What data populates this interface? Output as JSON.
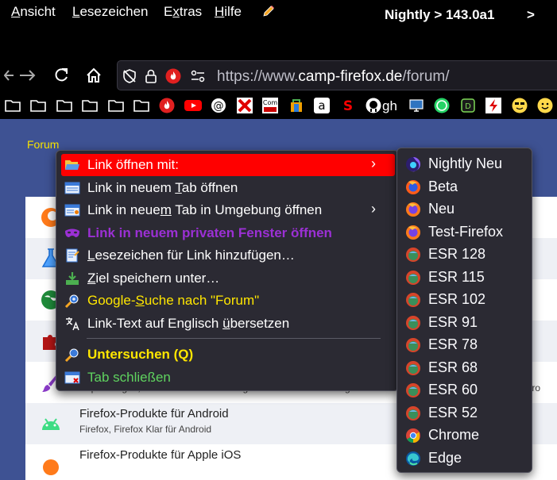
{
  "menubar": {
    "items": [
      "Ansicht",
      "Lesezeichen",
      "Extras",
      "Hilfe"
    ],
    "title": "Nightly > 143.0a1",
    "title_arrow": ">"
  },
  "navbar": {
    "url_prefix": "https://www.",
    "url_host": "camp-firefox.de",
    "url_path": "/forum/"
  },
  "bookmarks": {
    "label": "gh"
  },
  "page": {
    "breadcrumb": "Forum",
    "rows": [
      {
        "title": "",
        "desc": ""
      },
      {
        "title": "",
        "desc": ""
      },
      {
        "title": "",
        "desc": ""
      },
      {
        "title": "",
        "desc": ""
      },
      {
        "title": "",
        "desc": "Anpassungen, welche über Erweiterungen und Themes hinausg",
        "tail": "rChro"
      },
      {
        "title": "Firefox-Produkte für Android",
        "desc": "Firefox, Firefox Klar für Android"
      },
      {
        "title": "Firefox-Produkte für Apple iOS",
        "desc": ""
      }
    ]
  },
  "context_menu": {
    "items": [
      {
        "label": "Link öffnen mit:",
        "color": "#ffffff",
        "bold": false,
        "submenu": true,
        "highlight": true
      },
      {
        "pre": "Link in neuem ",
        "u": "T",
        "post": "ab öffnen",
        "color": "#ffffff"
      },
      {
        "pre": "Link in neue",
        "u": "m",
        "post": " Tab in Umgebung öffnen",
        "color": "#ffffff",
        "submenu": true
      },
      {
        "label": "Link in neuem privaten Fenster öffnen",
        "color": "#9b30d4",
        "bold": true
      },
      {
        "pre": "",
        "u": "L",
        "post": "esezeichen für Link hinzufügen…",
        "color": "#ffffff"
      },
      {
        "pre": "",
        "u": "Z",
        "post": "iel speichern unter…",
        "color": "#ffffff"
      },
      {
        "pre": "Google-",
        "u": "S",
        "post": "uche nach \"Forum\"",
        "color": "#ffe600"
      },
      {
        "pre": "Link-Text auf Englisch ",
        "u": "ü",
        "post": "bersetzen",
        "color": "#ffffff"
      },
      {
        "label": "Untersuchen (Q)",
        "color": "#ffe600",
        "bold": true
      },
      {
        "label": "Tab schließen",
        "color": "#5fd35f"
      }
    ]
  },
  "submenu": {
    "items": [
      {
        "label": "Nightly Neu",
        "icon": "nightly-icon"
      },
      {
        "label": "Beta",
        "icon": "firefox-beta-icon"
      },
      {
        "label": "Neu",
        "icon": "firefox-icon"
      },
      {
        "label": "Test-Firefox",
        "icon": "firefox-icon"
      },
      {
        "label": "ESR 128",
        "icon": "esr-icon"
      },
      {
        "label": "ESR 115",
        "icon": "esr-icon"
      },
      {
        "label": "ESR 102",
        "icon": "esr-icon"
      },
      {
        "label": "ESR 91",
        "icon": "esr-icon"
      },
      {
        "label": "ESR 78",
        "icon": "esr-icon"
      },
      {
        "label": "ESR 68",
        "icon": "esr-icon"
      },
      {
        "label": "ESR 60",
        "icon": "esr-icon"
      },
      {
        "label": "ESR 52",
        "icon": "esr-icon"
      },
      {
        "label": "Chrome",
        "icon": "chrome-icon"
      },
      {
        "label": "Edge",
        "icon": "edge-icon"
      }
    ]
  },
  "colors": {
    "highlight": "#ff0000",
    "menu_bg": "#2b2a33",
    "page_bg": "#3e5293",
    "breadcrumb": "#f7e300"
  }
}
